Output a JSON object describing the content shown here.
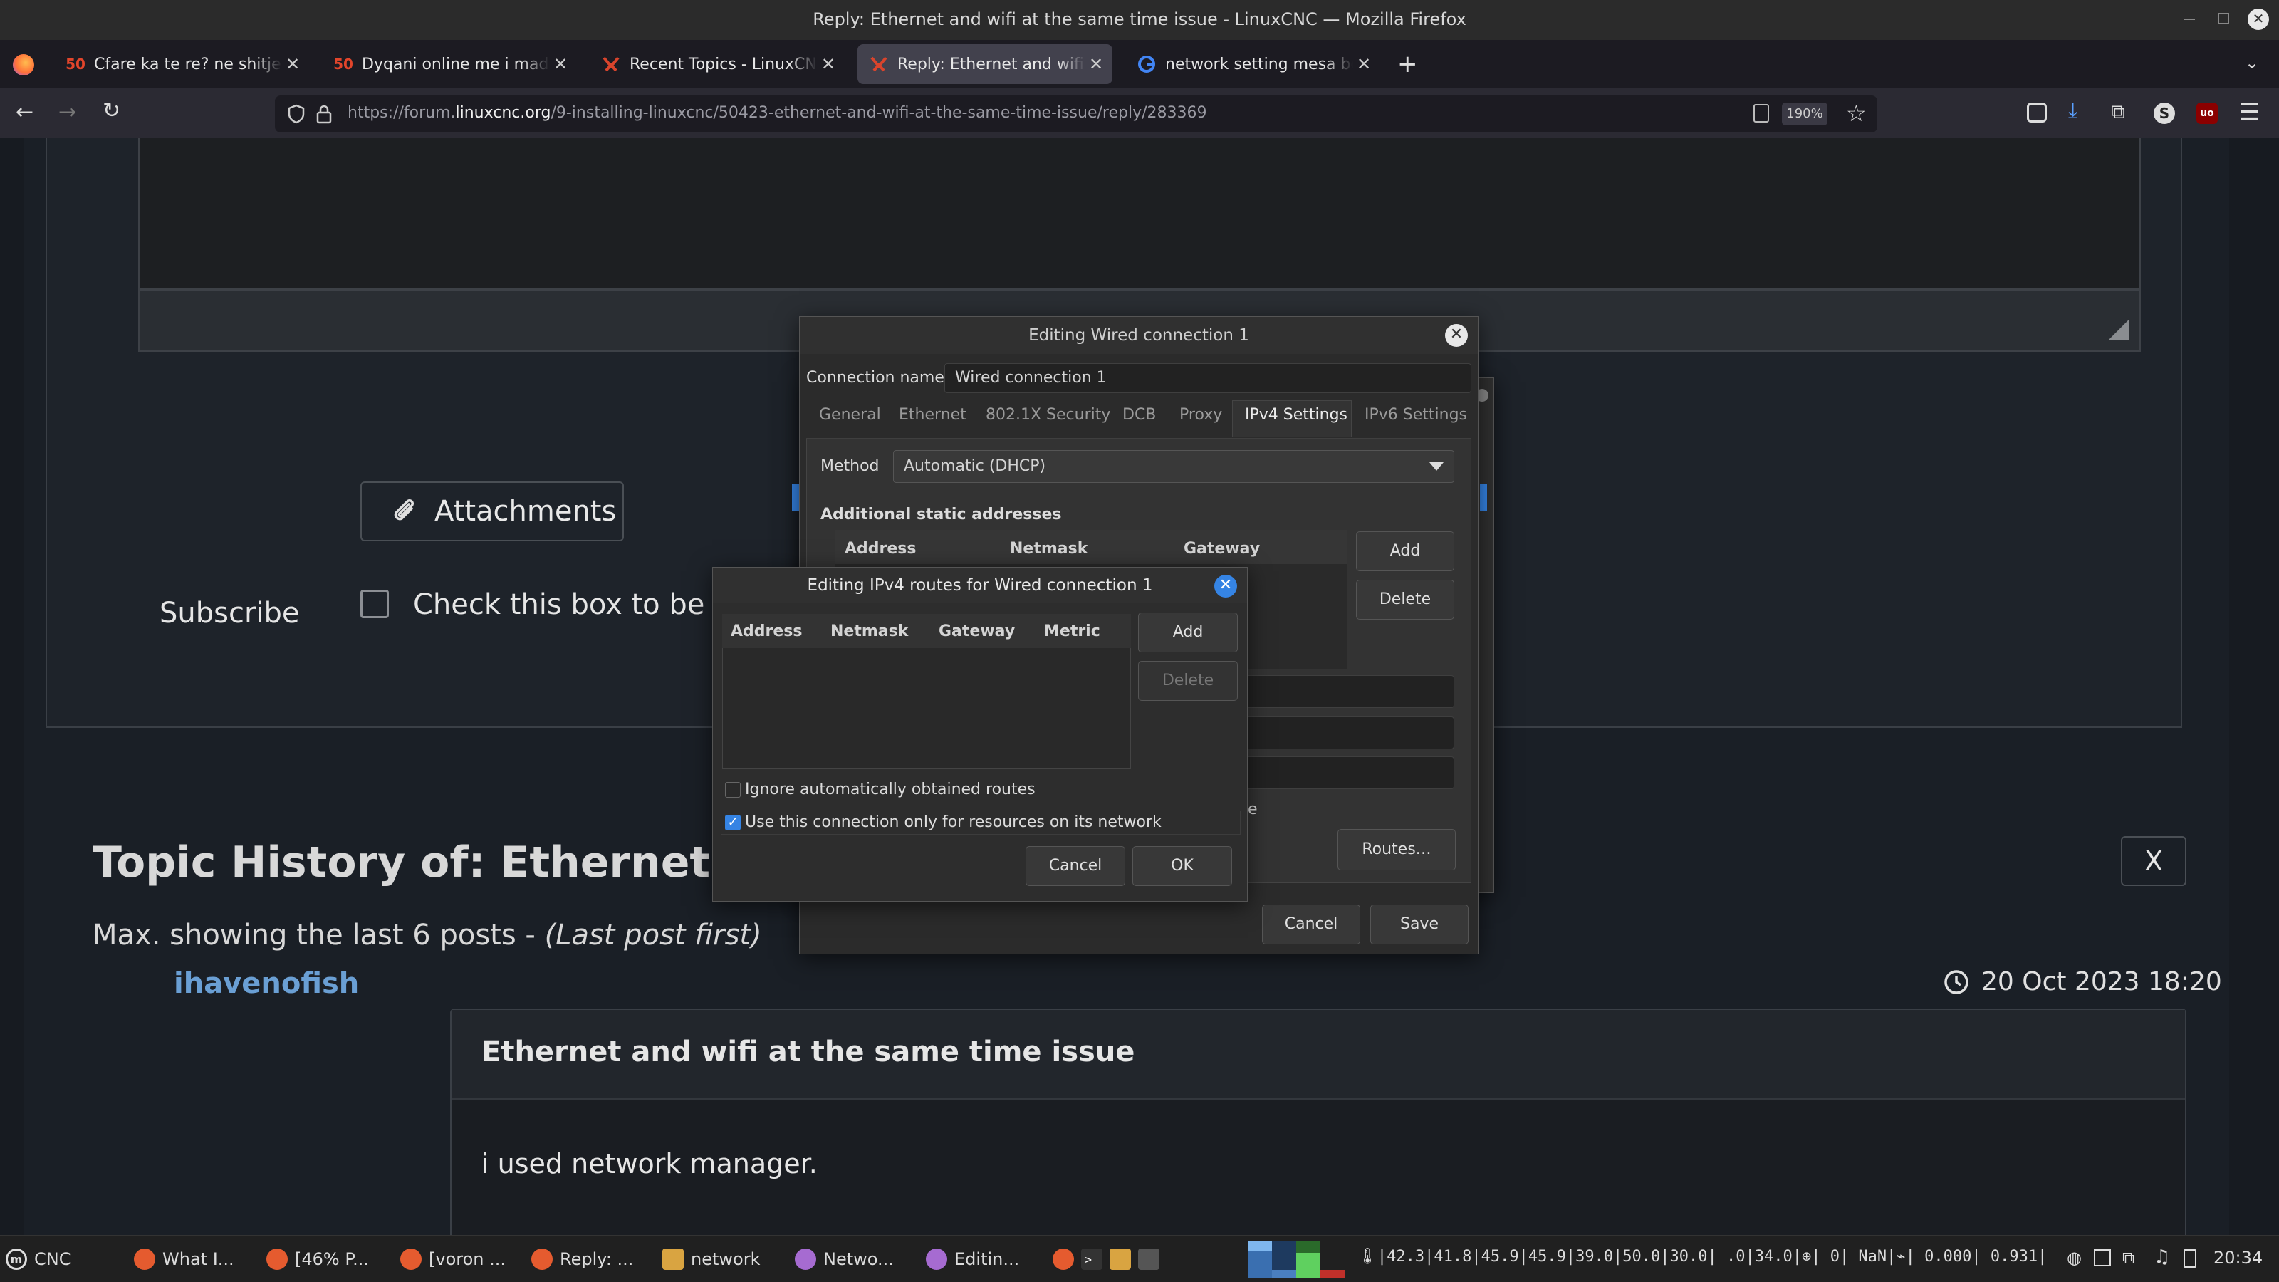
{
  "window": {
    "title": "Reply: Ethernet and wifi at the same time issue - LinuxCNC — Mozilla Firefox"
  },
  "tabs": [
    {
      "label": "Cfare ka te re? ne shitje - Bl",
      "fav": "50",
      "fav_color": "#e2452b"
    },
    {
      "label": "Dyqani online me i madh pe",
      "fav": "50",
      "fav_color": "#e2452b"
    },
    {
      "label": "Recent Topics - LinuxCNC",
      "fav": "linuxcnc",
      "fav_color": "#d9442c"
    },
    {
      "label": "Reply: Ethernet and wifi at t",
      "fav": "linuxcnc",
      "fav_color": "#d9442c"
    },
    {
      "label": "network setting mesa boarc",
      "fav": "G",
      "fav_color": "#4285f4"
    }
  ],
  "nav": {
    "url_prefix": "https://forum.",
    "url_host": "linuxcnc.org",
    "url_path": "/9-installing-linuxcnc/50423-ethernet-and-wifi-at-the-same-time-issue/reply/283369",
    "zoom": "190%"
  },
  "page": {
    "attachments": "Attachments",
    "subscribe": "Subscribe",
    "checkbox_label": "Check this box to be notified",
    "history_title": "Topic History of: Ethernet and wifi at the same time issue",
    "history_sub": "Max. showing the last 6 posts - ",
    "history_sub_italic": "(Last post first)",
    "close": "X",
    "user": "ihavenofish",
    "date": "20 Oct 2023 18:20",
    "post_title": "Ethernet and wifi at the same time issue",
    "post_body": "i used network manager."
  },
  "conn_dialog": {
    "title": "Editing Wired connection 1",
    "name_label": "Connection name",
    "name_value": "Wired connection 1",
    "tabs": [
      "General",
      "Ethernet",
      "802.1X Security",
      "DCB",
      "Proxy",
      "IPv4 Settings",
      "IPv6 Settings"
    ],
    "method_label": "Method",
    "method_value": "Automatic (DHCP)",
    "static_label": "Additional static addresses",
    "cols": [
      "Address",
      "Netmask",
      "Gateway"
    ],
    "add": "Add",
    "delete": "Delete",
    "partial_text": "e",
    "routes": "Routes…",
    "cancel": "Cancel",
    "save": "Save"
  },
  "routes_dialog": {
    "title": "Editing IPv4 routes for Wired connection 1",
    "cols": [
      "Address",
      "Netmask",
      "Gateway",
      "Metric"
    ],
    "add": "Add",
    "delete": "Delete",
    "ignore_label": "Ignore automatically obtained routes",
    "ignore_checked": false,
    "only_label": "Use this connection only for resources on its network",
    "only_checked": true,
    "cancel": "Cancel",
    "ok": "OK"
  },
  "taskbar": {
    "menu": "CNC",
    "tasks": [
      "What I...",
      "[46% P...",
      "[voron ...",
      "Reply: ...",
      "network",
      "Netwo...",
      "Editin..."
    ],
    "status": "🌡|42.3|41.8|45.9|45.9|39.0|50.0|30.0| .0|34.0|⊕| 0| NaN|⌁| 0.000| 0.931|",
    "time": "20:34"
  }
}
